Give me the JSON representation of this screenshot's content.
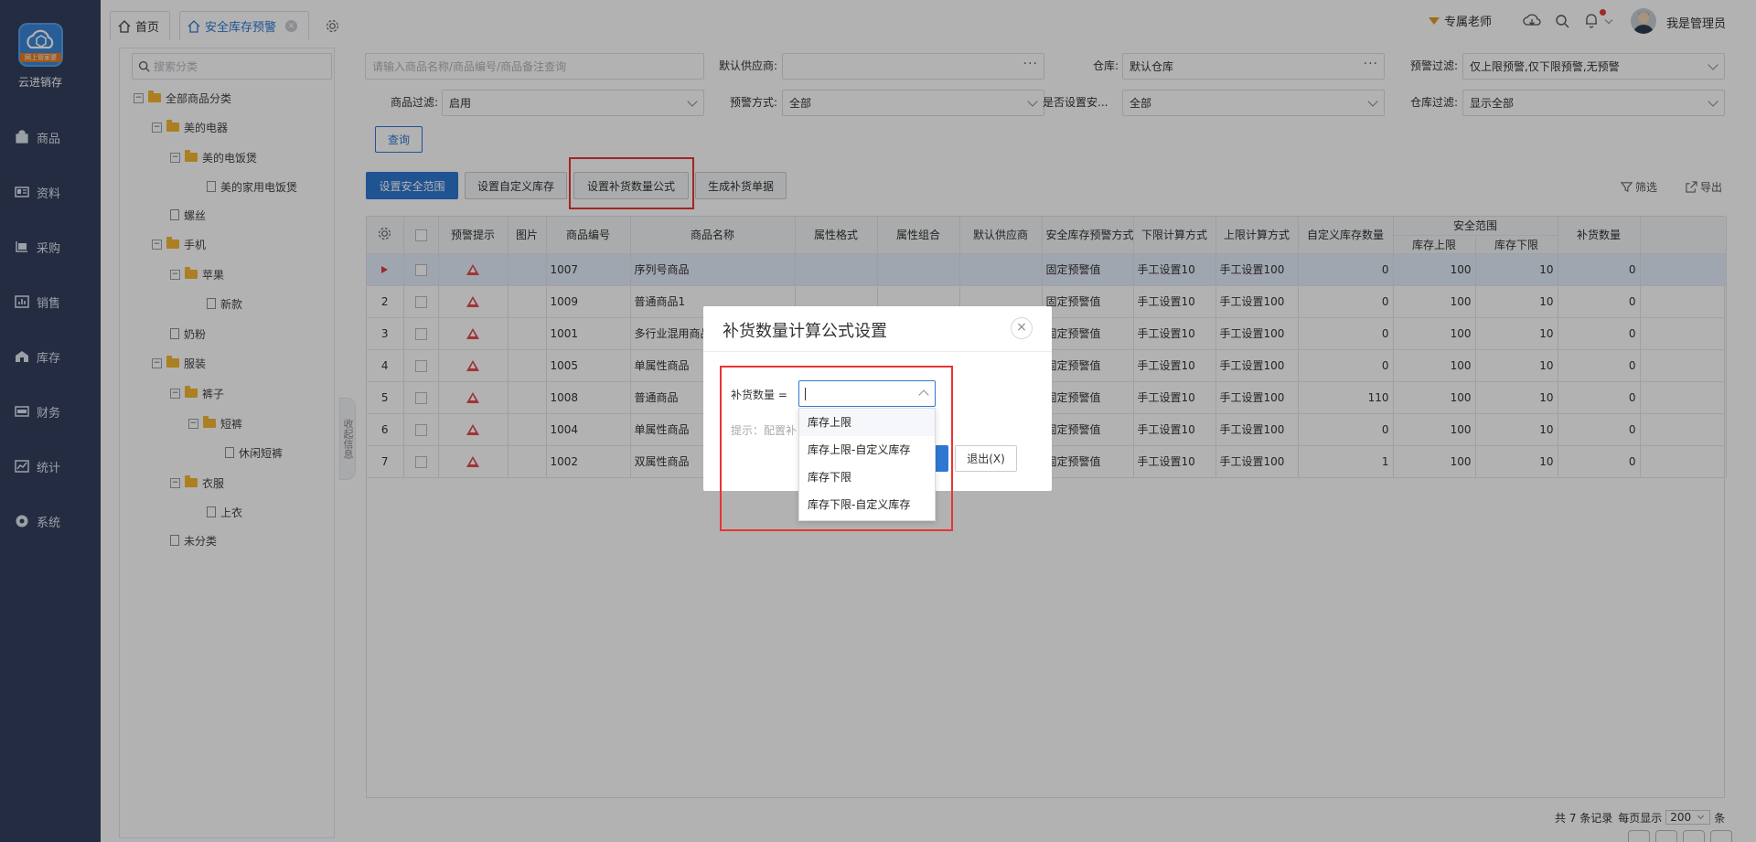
{
  "sidebar": {
    "logo_text": "网上管家婆",
    "brand": "云进销存",
    "items": [
      {
        "label": "商品",
        "icon": "bag-icon"
      },
      {
        "label": "资料",
        "icon": "id-card-icon"
      },
      {
        "label": "采购",
        "icon": "purchase-icon"
      },
      {
        "label": "销售",
        "icon": "chart-icon"
      },
      {
        "label": "库存",
        "icon": "warehouse-icon"
      },
      {
        "label": "财务",
        "icon": "finance-icon"
      },
      {
        "label": "统计",
        "icon": "trend-icon"
      },
      {
        "label": "系统",
        "icon": "settings-icon"
      }
    ]
  },
  "tabs": [
    {
      "label": "首页"
    },
    {
      "label": "安全库存预警"
    }
  ],
  "topbar": {
    "teacher": "专属老师",
    "user": "我是管理员"
  },
  "tree": {
    "search_placeholder": "搜索分类",
    "nodes": [
      {
        "label": "全部商品分类",
        "level": 0,
        "type": "folder",
        "toggle": "−"
      },
      {
        "label": "美的电器",
        "level": 1,
        "type": "folder",
        "toggle": "−"
      },
      {
        "label": "美的电饭煲",
        "level": 2,
        "type": "folder",
        "toggle": "−"
      },
      {
        "label": "美的家用电饭煲",
        "level": 3,
        "type": "file"
      },
      {
        "label": "螺丝",
        "level": 1,
        "type": "file"
      },
      {
        "label": "手机",
        "level": 1,
        "type": "folder",
        "toggle": "−"
      },
      {
        "label": "苹果",
        "level": 2,
        "type": "folder",
        "toggle": "−"
      },
      {
        "label": "新款",
        "level": 3,
        "type": "file"
      },
      {
        "label": "奶粉",
        "level": 1,
        "type": "file"
      },
      {
        "label": "服装",
        "level": 1,
        "type": "folder",
        "toggle": "−"
      },
      {
        "label": "裤子",
        "level": 2,
        "type": "folder",
        "toggle": "−"
      },
      {
        "label": "短裤",
        "level": 3,
        "type": "folder",
        "toggle": "−"
      },
      {
        "label": "休闲短裤",
        "level": 4,
        "type": "file"
      },
      {
        "label": "衣服",
        "level": 2,
        "type": "folder",
        "toggle": "−"
      },
      {
        "label": "上衣",
        "level": 3,
        "type": "file"
      },
      {
        "label": "未分类",
        "level": 1,
        "type": "file"
      }
    ],
    "collapse_label": "收起信息"
  },
  "filters": {
    "search_placeholder": "请输入商品名称/商品编号/商品备注查询",
    "supplier_label": "默认供应商:",
    "supplier_value": "",
    "warehouse_label": "仓库:",
    "warehouse_value": "默认仓库",
    "alert_filter_label": "预警过滤:",
    "alert_filter_value": "仅上限预警,仅下限预警,无预警",
    "product_filter_label": "商品过滤:",
    "product_filter_value": "启用",
    "alert_mode_label": "预警方式:",
    "alert_mode_value": "全部",
    "safety_set_label": "是否设置安...",
    "safety_set_value": "全部",
    "warehouse_filter_label": "仓库过滤:",
    "warehouse_filter_value": "显示全部",
    "query_button": "查询"
  },
  "toolbar": {
    "set_safety_range": "设置安全范围",
    "set_custom_stock": "设置自定义库存",
    "set_formula": "设置补货数量公式",
    "generate_doc": "生成补货单据",
    "filter": "筛选",
    "export": "导出"
  },
  "grid": {
    "headers": {
      "alert": "预警提示",
      "image": "图片",
      "code": "商品编号",
      "name": "商品名称",
      "spec": "属性格式",
      "combo": "属性组合",
      "supplier": "默认供应商",
      "alert_mode": "安全库存预警方式",
      "lower_calc": "下限计算方式",
      "upper_calc": "上限计算方式",
      "custom_qty": "自定义库存数量",
      "safety_range": "安全范围",
      "upper": "库存上限",
      "lower": "库存下限",
      "replenish": "补货数量"
    },
    "rows": [
      {
        "no": "",
        "code": "1007",
        "name": "序列号商品",
        "alert_mode": "固定预警值",
        "lower_calc": "手工设置10",
        "upper_calc": "手工设置100",
        "custom": "0",
        "upper": "100",
        "lower": "10",
        "replenish": "0"
      },
      {
        "no": "2",
        "code": "1009",
        "name": "普通商品1",
        "alert_mode": "固定预警值",
        "lower_calc": "手工设置10",
        "upper_calc": "手工设置100",
        "custom": "0",
        "upper": "100",
        "lower": "10",
        "replenish": "0"
      },
      {
        "no": "3",
        "code": "1001",
        "name": "多行业混用商品",
        "alert_mode": "固定预警值",
        "lower_calc": "手工设置10",
        "upper_calc": "手工设置100",
        "custom": "0",
        "upper": "100",
        "lower": "10",
        "replenish": "0"
      },
      {
        "no": "4",
        "code": "1005",
        "name": "单属性商品",
        "alert_mode": "固定预警值",
        "lower_calc": "手工设置10",
        "upper_calc": "手工设置100",
        "custom": "0",
        "upper": "100",
        "lower": "10",
        "replenish": "0"
      },
      {
        "no": "5",
        "code": "1008",
        "name": "普通商品",
        "alert_mode": "固定预警值",
        "lower_calc": "手工设置10",
        "upper_calc": "手工设置100",
        "custom": "110",
        "upper": "100",
        "lower": "10",
        "replenish": "0"
      },
      {
        "no": "6",
        "code": "1004",
        "name": "单属性商品",
        "alert_mode": "固定预警值",
        "lower_calc": "手工设置10",
        "upper_calc": "手工设置100",
        "custom": "0",
        "upper": "100",
        "lower": "10",
        "replenish": "0"
      },
      {
        "no": "7",
        "code": "1002",
        "name": "双属性商品",
        "alert_mode": "固定预警值",
        "lower_calc": "手工设置10",
        "upper_calc": "手工设置100",
        "custom": "1",
        "upper": "100",
        "lower": "10",
        "replenish": "0"
      }
    ]
  },
  "footer": {
    "total": "共 7 条记录",
    "per_page_label": "每页显示",
    "per_page_value": "200",
    "unit": "条"
  },
  "dialog": {
    "title": "补货数量计算公式设置",
    "field_label": "补货数量 =",
    "hint": "提示：配置补",
    "exit_button": "退出(X)",
    "options": [
      "库存上限",
      "库存上限-自定义库存",
      "库存下限",
      "库存下限-自定义库存"
    ]
  },
  "colors": {
    "sidebar": "#33405e",
    "accent": "#2f78d1",
    "highlight_red": "#e83535"
  }
}
